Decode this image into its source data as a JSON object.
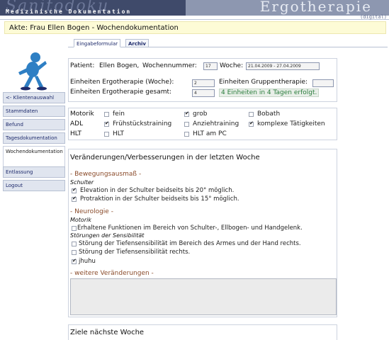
{
  "header": {
    "logo_script": "Sanitodoku",
    "logo_sub": "Medizinische Dokumentation",
    "title": "Ergotherapie",
    "edition": "(digital)"
  },
  "akte": "Akte: Frau Ellen Bogen - Wochendokumentation",
  "tabs": [
    {
      "label": "Eingabeformular",
      "active": true
    },
    {
      "label": "Archiv",
      "active": false
    }
  ],
  "sidebar": {
    "items": [
      {
        "label": "<- Klientenauswahl"
      },
      {
        "label": "Stammdaten"
      },
      {
        "label": "Befund"
      },
      {
        "label": "Tagesdokumentation"
      },
      {
        "label": "Wochendokumentation",
        "active": true
      },
      {
        "label": "Entlassung"
      },
      {
        "label": "Logout"
      }
    ]
  },
  "patient": {
    "patient_label": "Patient:",
    "patient_name": "Ellen Bogen,",
    "wochennummer_label": "Wochennummer:",
    "wochennummer_value": "17",
    "woche_label": "Woche:",
    "woche_value": "21.04.2009 - 27.04.2009",
    "einheiten_woche_label": "Einheiten Ergotherapie (Woche):",
    "einheiten_woche_value": "2",
    "gruppen_label": "Einheiten Gruppentherapie:",
    "gruppen_value": "",
    "einheiten_gesamt_label": "Einheiten Ergotherapie gesamt:",
    "einheiten_gesamt_value": "4",
    "success_message": "4 Einheiten in 4 Tagen erfolgt."
  },
  "categories": [
    {
      "label": "Motorik",
      "options": [
        {
          "label": "fein",
          "checked": false
        },
        {
          "label": "grob",
          "checked": true
        },
        {
          "label": "Bobath",
          "checked": false
        }
      ]
    },
    {
      "label": "ADL",
      "options": [
        {
          "label": "Frühstückstraining",
          "checked": true
        },
        {
          "label": "Anziehtraining",
          "checked": false
        },
        {
          "label": "komplexe Tätigkeiten",
          "checked": true
        }
      ]
    },
    {
      "label": "HLT",
      "options": [
        {
          "label": "HLT",
          "checked": false
        },
        {
          "label": "HLT am PC",
          "checked": false
        }
      ]
    }
  ],
  "veraenderungen": {
    "title": "Veränderungen/Verbesserungen in der letzten Woche",
    "bewegung": {
      "category": "- Bewegungsausmaß -",
      "subcategory": "Schulter",
      "items": [
        {
          "label": "Elevation in der Schulter beidseits bis 20° möglich.",
          "checked": true
        },
        {
          "label": "Protraktion in der Schulter beidseits bis 15° möglich.",
          "checked": true
        }
      ]
    },
    "neurologie": {
      "category": "- Neurologie -",
      "subcategory": "Motorik",
      "items_motorik": [
        {
          "label": "Erhaltene Funktionen im Bereich von Schulter-, Ellbogen- und Handgelenk.",
          "checked": false
        }
      ],
      "subcategory2": "Störungen der Sensibilität",
      "items_sensibilitaet": [
        {
          "label": "Störung der Tiefensensibilität im Bereich des Armes und der Hand rechts.",
          "checked": false
        },
        {
          "label": "Störung der Tiefensensibilität rechts.",
          "checked": false
        },
        {
          "label": "jhuhu",
          "checked": true
        }
      ]
    },
    "weitere": "- weitere Veränderungen -"
  },
  "ziele": {
    "title": "Ziele nächste Woche"
  },
  "colors": {
    "header_dark": "#3f4a6a",
    "header_band": "#8d97b0",
    "akte_bg": "#fdfbd6",
    "success": "#2a7d3c",
    "category": "#8a4b2a"
  }
}
